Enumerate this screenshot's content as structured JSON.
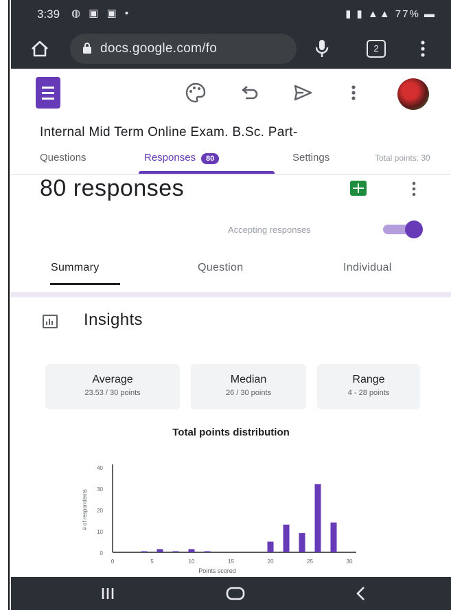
{
  "status_bar": {
    "time": "3:39",
    "battery": "77%"
  },
  "browser": {
    "url": "docs.google.com/fo"
  },
  "form": {
    "title": "Internal Mid Term Online Exam. B.Sc. Part-",
    "tabs": [
      {
        "label": "Questions"
      },
      {
        "label": "Responses",
        "badge": "80"
      },
      {
        "label": "Settings"
      }
    ],
    "total_points": "Total points: 30"
  },
  "responses": {
    "count_label": "80 responses",
    "accepting_label": "Accepting responses",
    "accepting": true,
    "subtabs": [
      "Summary",
      "Question",
      "Individual"
    ]
  },
  "insights": {
    "title": "Insights",
    "stats": [
      {
        "label": "Average",
        "value": "23.53 / 30 points"
      },
      {
        "label": "Median",
        "value": "26 / 30 points"
      },
      {
        "label": "Range",
        "value": "4 - 28 points"
      }
    ]
  },
  "chart_data": {
    "type": "bar",
    "title": "Total points distribution",
    "xlabel": "Points scored",
    "ylabel": "# of respondents",
    "x": [
      4,
      6,
      8,
      10,
      12,
      20,
      22,
      24,
      26,
      28
    ],
    "values": [
      0.5,
      1.5,
      0.5,
      1.5,
      0.5,
      5,
      13,
      9,
      32,
      14
    ],
    "xlim": [
      0,
      30
    ],
    "ylim": [
      0,
      40
    ],
    "xticks": [
      0,
      5,
      10,
      15,
      20,
      25,
      30
    ],
    "yticks": [
      0,
      10,
      20,
      30,
      40
    ],
    "color": "#673ab7",
    "grid": false
  },
  "colors": {
    "accent": "#673ab7",
    "chrome": "#2b2f36",
    "divider": "#ede7f6"
  }
}
